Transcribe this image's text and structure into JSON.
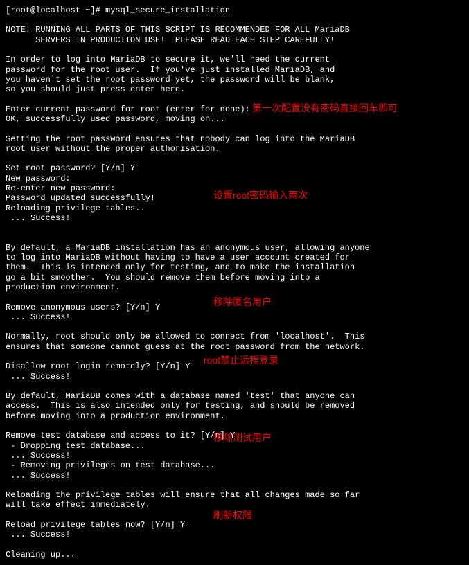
{
  "terminal": {
    "lines": [
      "[root@localhost ~]# mysql_secure_installation",
      "",
      "NOTE: RUNNING ALL PARTS OF THIS SCRIPT IS RECOMMENDED FOR ALL MariaDB",
      "      SERVERS IN PRODUCTION USE!  PLEASE READ EACH STEP CAREFULLY!",
      "",
      "In order to log into MariaDB to secure it, we'll need the current",
      "password for the root user.  If you've just installed MariaDB, and",
      "you haven't set the root password yet, the password will be blank,",
      "so you should just press enter here.",
      "",
      "Enter current password for root (enter for none):",
      "OK, successfully used password, moving on...",
      "",
      "Setting the root password ensures that nobody can log into the MariaDB",
      "root user without the proper authorisation.",
      "",
      "Set root password? [Y/n] Y",
      "New password:",
      "Re-enter new password:",
      "Password updated successfully!",
      "Reloading privilege tables..",
      " ... Success!",
      "",
      "",
      "By default, a MariaDB installation has an anonymous user, allowing anyone",
      "to log into MariaDB without having to have a user account created for",
      "them.  This is intended only for testing, and to make the installation",
      "go a bit smoother.  You should remove them before moving into a",
      "production environment.",
      "",
      "Remove anonymous users? [Y/n] Y",
      " ... Success!",
      "",
      "Normally, root should only be allowed to connect from 'localhost'.  This",
      "ensures that someone cannot guess at the root password from the network.",
      "",
      "Disallow root login remotely? [Y/n] Y",
      " ... Success!",
      "",
      "By default, MariaDB comes with a database named 'test' that anyone can",
      "access.  This is also intended only for testing, and should be removed",
      "before moving into a production environment.",
      "",
      "Remove test database and access to it? [Y/n] Y",
      " - Dropping test database...",
      " ... Success!",
      " - Removing privileges on test database...",
      " ... Success!",
      "",
      "Reloading the privilege tables will ensure that all changes made so far",
      "will take effect immediately.",
      "",
      "Reload privilege tables now? [Y/n] Y",
      " ... Success!",
      "",
      "Cleaning up..."
    ]
  },
  "annotations": {
    "a1": "第一次配置没有密码直接回车即可",
    "a2": "设置root密码输入两次",
    "a3": "移除匿名用户",
    "a4": "root禁止远程登录",
    "a5": "移除测试用户",
    "a6": "刷新权限"
  }
}
